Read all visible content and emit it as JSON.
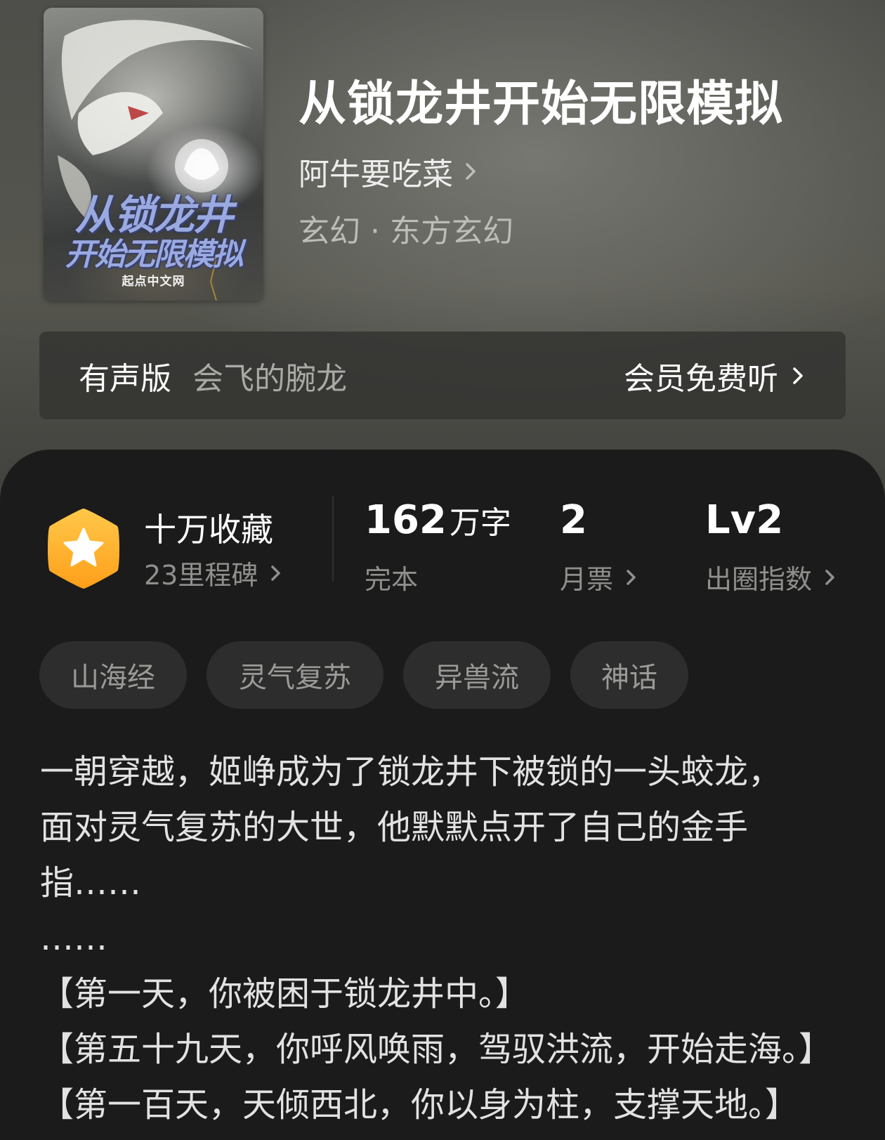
{
  "book": {
    "title": "从锁龙井开始无限模拟",
    "author": "阿牛要吃菜",
    "genre": "玄幻 · 东方玄幻",
    "cover": {
      "title_line_1": "从锁龙井",
      "title_line_2": "开始无限模拟",
      "publisher": "起点中文网"
    }
  },
  "audio": {
    "label": "有声版",
    "narrator": "会飞的腕龙",
    "action": "会员免费听"
  },
  "stats": {
    "collect_label": "十万收藏",
    "milestone": "23里程碑",
    "word_count": "162",
    "word_unit": "万字",
    "status": "完本",
    "monthly_tickets": "2",
    "monthly_tickets_label": "月票",
    "popularity_level": "Lv2",
    "popularity_label": "出圈指数"
  },
  "tags": [
    "山海经",
    "灵气复苏",
    "异兽流",
    "神话"
  ],
  "synopsis": [
    "一朝穿越，姬峥成为了锁龙井下被锁的一头蛟龙，",
    "面对灵气复苏的大世，他默默点开了自己的金手",
    "指……",
    "……",
    "【第一天，你被困于锁龙井中。】",
    "【第五十九天，你呼风唤雨，驾驭洪流，开始走海。】",
    "【第一百天，天倾西北，你以身为柱，支撑天地。】"
  ],
  "colors": {
    "background": "#1b1b1b",
    "badge_gradient_top": "#ffc84a",
    "badge_gradient_bottom": "#ff9f1a",
    "tag_background": "#2d2d2d"
  },
  "icons": {
    "badge": "star-hexagon-icon",
    "chevron": "chevron-right-icon"
  }
}
